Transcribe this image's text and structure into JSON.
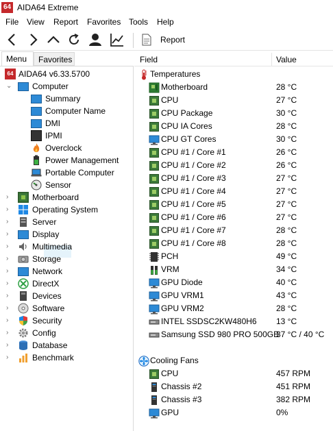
{
  "app": {
    "icon_text": "64",
    "title": "AIDA64 Extreme"
  },
  "menu": [
    "File",
    "View",
    "Report",
    "Favorites",
    "Tools",
    "Help"
  ],
  "toolbar": {
    "report_label": "Report"
  },
  "tabs": {
    "menu": "Menu",
    "favorites": "Favorites"
  },
  "tree": {
    "root": "AIDA64 v6.33.5700",
    "computer": "Computer",
    "computer_children": [
      "Summary",
      "Computer Name",
      "DMI",
      "IPMI",
      "Overclock",
      "Power Management",
      "Portable Computer",
      "Sensor"
    ],
    "categories": [
      "Motherboard",
      "Operating System",
      "Server",
      "Display",
      "Multimedia",
      "Storage",
      "Network",
      "DirectX",
      "Devices",
      "Software",
      "Security",
      "Config",
      "Database",
      "Benchmark"
    ]
  },
  "columns": {
    "field": "Field",
    "value": "Value"
  },
  "temperatures": {
    "label": "Temperatures",
    "rows": [
      {
        "field": "Motherboard",
        "value": "28 °C",
        "icon": "motherboard-icon"
      },
      {
        "field": "CPU",
        "value": "27 °C",
        "icon": "chip-icon"
      },
      {
        "field": "CPU Package",
        "value": "30 °C",
        "icon": "chip-icon"
      },
      {
        "field": "CPU IA Cores",
        "value": "28 °C",
        "icon": "chip-icon"
      },
      {
        "field": "CPU GT Cores",
        "value": "30 °C",
        "icon": "gpu-icon"
      },
      {
        "field": "CPU #1 / Core #1",
        "value": "26 °C",
        "icon": "chip-icon"
      },
      {
        "field": "CPU #1 / Core #2",
        "value": "26 °C",
        "icon": "chip-icon"
      },
      {
        "field": "CPU #1 / Core #3",
        "value": "27 °C",
        "icon": "chip-icon"
      },
      {
        "field": "CPU #1 / Core #4",
        "value": "27 °C",
        "icon": "chip-icon"
      },
      {
        "field": "CPU #1 / Core #5",
        "value": "27 °C",
        "icon": "chip-icon"
      },
      {
        "field": "CPU #1 / Core #6",
        "value": "27 °C",
        "icon": "chip-icon"
      },
      {
        "field": "CPU #1 / Core #7",
        "value": "28 °C",
        "icon": "chip-icon"
      },
      {
        "field": "CPU #1 / Core #8",
        "value": "28 °C",
        "icon": "chip-icon"
      },
      {
        "field": "PCH",
        "value": "49 °C",
        "icon": "pch-icon"
      },
      {
        "field": "VRM",
        "value": "34 °C",
        "icon": "vrm-icon"
      },
      {
        "field": "GPU Diode",
        "value": "40 °C",
        "icon": "gpu-icon"
      },
      {
        "field": "GPU VRM1",
        "value": "43 °C",
        "icon": "gpu-icon"
      },
      {
        "field": "GPU VRM2",
        "value": "28 °C",
        "icon": "gpu-icon"
      },
      {
        "field": "INTEL SSDSC2KW480H6",
        "value": "13 °C",
        "icon": "drive-icon"
      },
      {
        "field": "Samsung SSD 980 PRO 500GB",
        "value": "37 °C / 40 °C",
        "icon": "drive-icon"
      }
    ]
  },
  "fans": {
    "label": "Cooling Fans",
    "rows": [
      {
        "field": "CPU",
        "value": "457 RPM",
        "icon": "chip-icon"
      },
      {
        "field": "Chassis #2",
        "value": "451 RPM",
        "icon": "chassis-icon"
      },
      {
        "field": "Chassis #3",
        "value": "382 RPM",
        "icon": "chassis-icon"
      },
      {
        "field": "GPU",
        "value": "0%",
        "icon": "gpu-icon"
      }
    ]
  }
}
